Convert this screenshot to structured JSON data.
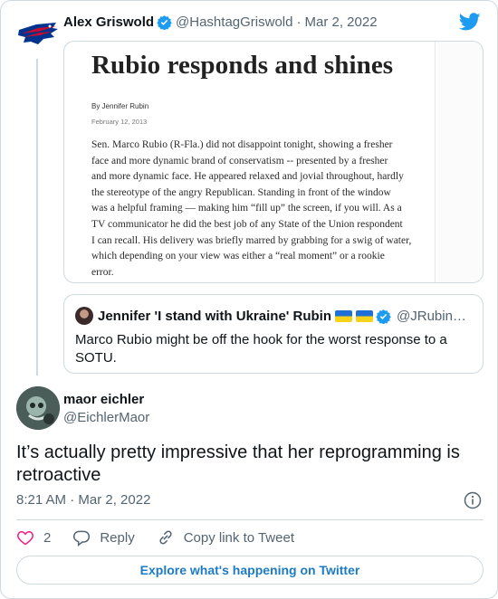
{
  "parent_tweet": {
    "name": "Alex Griswold",
    "handle": "@HashtagGriswold",
    "separator": "·",
    "date": "Mar 2, 2022",
    "article": {
      "headline": "Rubio responds and shines",
      "byline": "By Jennifer Rubin",
      "date": "February 12, 2013",
      "body_lines": [
        "Sen. Marco Rubio (R-Fla.) did not disappoint tonight, showing a fresher",
        "face and more dynamic brand of conservatism -- presented by a fresher",
        "and more dynamic face. He appeared relaxed and jovial throughout, hardly",
        "the stereotype of the angry Republican. Standing in front of the window",
        "was a helpful  framing — making him “fill up” the screen, if you will. As a",
        "TV communicator he did the best job of any State of the Union respondent",
        "I can recall. His delivery was briefly marred by grabbing for a swig of water,",
        "which depending on your view was either a “real moment” or a rookie",
        "error."
      ]
    },
    "quoted": {
      "name": "Jennifer 'I stand with Ukraine' Rubin",
      "handle": "@JRubin…",
      "text": "Marco Rubio might be off the hook for the worst response to a SOTU."
    }
  },
  "main_tweet": {
    "name": "maor eichler",
    "handle": "@EichlerMaor",
    "text": "It’s actually pretty impressive that her reprogramming is retroactive",
    "timestamp": "8:21 AM · Mar 2, 2022"
  },
  "actions": {
    "like_count": "2",
    "reply_label": "Reply",
    "copy_label": "Copy link to Tweet"
  },
  "explore_label": "Explore what's happening on Twitter",
  "colors": {
    "twitter_blue": "#1d9bf0",
    "like_red": "#f91880",
    "secondary_text": "#536471",
    "border": "#cfd9de",
    "bills_blue": "#00338d",
    "bills_red": "#c60c30"
  },
  "icons": [
    "bills-logo-icon",
    "verified-badge-icon",
    "twitter-bird-icon",
    "ukraine-flag-icon",
    "info-icon",
    "heart-icon",
    "reply-icon",
    "link-icon"
  ]
}
